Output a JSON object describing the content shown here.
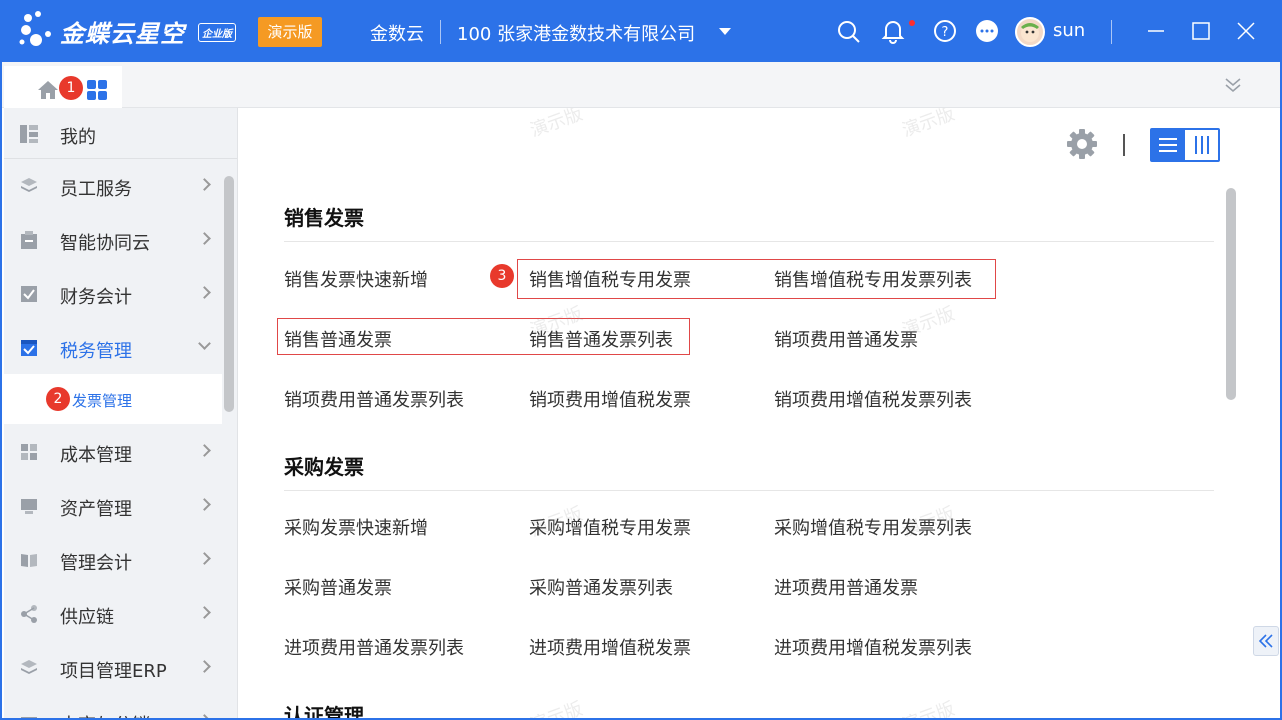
{
  "header": {
    "brand": "金蝶云星空",
    "brand_badge": "企业版",
    "demo_label": "演示版",
    "org": "金数云",
    "company": "100  张家港金数技术有限公司",
    "user": "sun",
    "colors": {
      "primary": "#2c72e8",
      "demo": "#f59a23",
      "badge": "#e8392c"
    }
  },
  "tabbar": {
    "home_badge": "1"
  },
  "sidebar": {
    "items": [
      {
        "label": "我的",
        "icon": "dashboard-icon"
      },
      {
        "label": "员工服务",
        "icon": "layers-icon"
      },
      {
        "label": "智能协同云",
        "icon": "clipboard-icon"
      },
      {
        "label": "财务会计",
        "icon": "check-box-icon"
      },
      {
        "label": "税务管理",
        "icon": "tax-icon",
        "active": true
      },
      {
        "label": "成本管理",
        "icon": "grid-icon"
      },
      {
        "label": "资产管理",
        "icon": "monitor-icon"
      },
      {
        "label": "管理会计",
        "icon": "book-icon"
      },
      {
        "label": "供应链",
        "icon": "share-icon"
      },
      {
        "label": "项目管理ERP",
        "icon": "layers-icon"
      },
      {
        "label": "电商与分销",
        "icon": "store-icon"
      }
    ],
    "sub_item": {
      "label": "发票管理",
      "badge": "2"
    }
  },
  "main": {
    "sections": [
      {
        "title": "销售发票",
        "links": [
          "销售发票快速新增",
          "销售增值税专用发票",
          "销售增值税专用发票列表",
          "销售普通发票",
          "销售普通发票列表",
          "销项费用普通发票",
          "销项费用普通发票列表",
          "销项费用增值税发票",
          "销项费用增值税发票列表"
        ]
      },
      {
        "title": "采购发票",
        "links": [
          "采购发票快速新增",
          "采购增值税专用发票",
          "采购增值税专用发票列表",
          "采购普通发票",
          "采购普通发票列表",
          "进项费用普通发票",
          "进项费用普通发票列表",
          "进项费用增值税发票",
          "进项费用增值税发票列表"
        ]
      },
      {
        "title": "认证管理"
      }
    ],
    "marker_badge": "3",
    "watermark": "演示版"
  }
}
